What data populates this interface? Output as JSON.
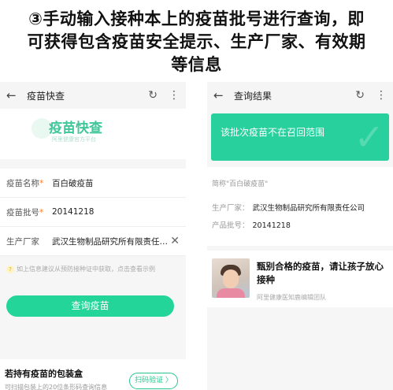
{
  "caption": {
    "lines": [
      "③手动输入接种本上的疫苗批号进行查询，即",
      "可获得包含疫苗安全提示、生产厂家、有效期",
      "等信息"
    ]
  },
  "left_screen": {
    "topbar": {
      "title": "疫苗快查"
    },
    "banner": {
      "title": "疫苗快查",
      "subtitle": "阿里健康官方平台"
    },
    "form": {
      "name_label": "疫苗名称",
      "name_value": "百白破疫苗",
      "batch_label": "疫苗批号",
      "batch_value": "20141218",
      "maker_label": "生产厂家",
      "maker_value": "武汉生物制品研究所有限责任…"
    },
    "tip": "如上信息建议从预防接种证中获取，点击查看示例",
    "query_button": "查询疫苗",
    "bottom_card": {
      "title": "若持有疫苗的包装盒",
      "subtitle": "可扫描包装上的20位条形码查询信息",
      "scan_button": "扫码验证 〉"
    }
  },
  "right_screen": {
    "topbar": {
      "title": "查询结果"
    },
    "result_banner": "该批次疫苗不在召回范围",
    "info": {
      "abbr": "简称\"百白破疫苗\"",
      "maker_label": "生产厂家：",
      "maker_value": "武汉生物制品研究所有限责任公司",
      "batch_label": "产品批号：",
      "batch_value": "20141218"
    },
    "article": {
      "title": "甄别合格的疫苗，请让孩子放心接种",
      "source": "阿里健康医知鹿编辑团队"
    }
  },
  "icons": {
    "back": "arrow-left-icon",
    "refresh": "refresh-icon",
    "more": "more-vertical-icon",
    "clear": "clear-x-icon",
    "help": "question-icon",
    "check": "checkmark-icon"
  },
  "colors": {
    "accent_green": "#24d59a",
    "result_green": "#27d09c",
    "required_mark": "#ff7d2a"
  }
}
